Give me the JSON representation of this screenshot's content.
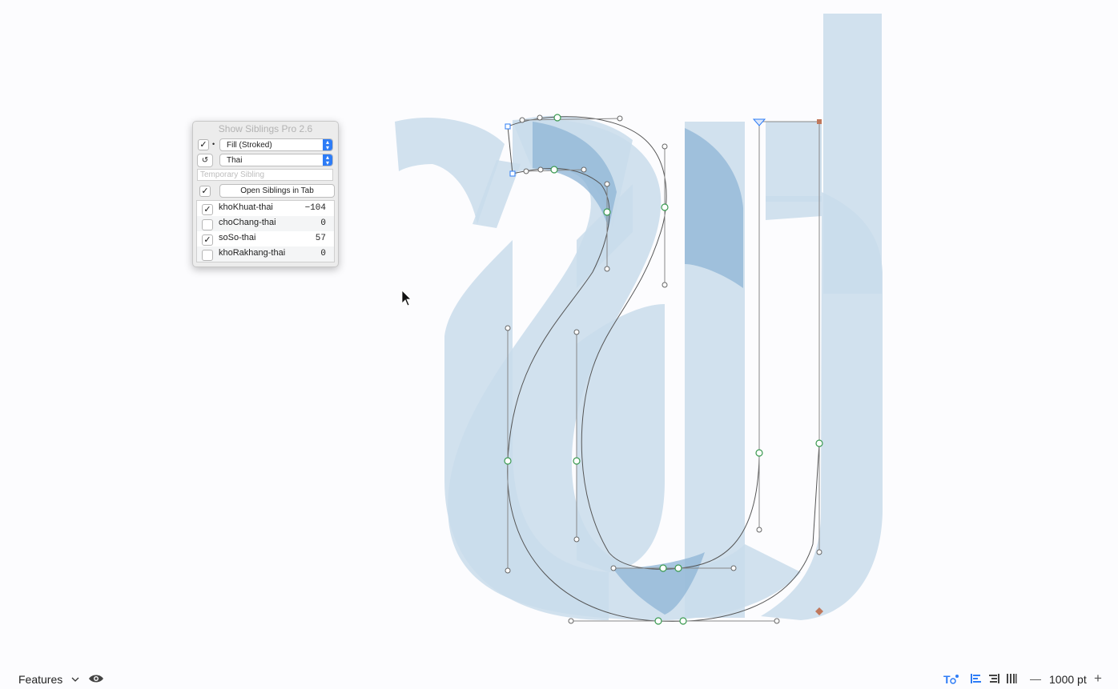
{
  "palette": {
    "title": "Show Siblings Pro 2.6",
    "fill_mode": "Fill (Stroked)",
    "script": "Thai",
    "temp_sibling_placeholder": "Temporary Sibling",
    "open_siblings_label": "Open Siblings in Tab",
    "refresh_icon": "↺",
    "siblings": [
      {
        "name": "khoKhuat-thai",
        "value": "−104",
        "checked": true
      },
      {
        "name": "choChang-thai",
        "value": "0",
        "checked": false
      },
      {
        "name": "soSo-thai",
        "value": "57",
        "checked": true
      },
      {
        "name": "khoRakhang-thai",
        "value": "0",
        "checked": false
      }
    ]
  },
  "bottombar": {
    "features_label": "Features",
    "zoom_value": "1000 pt",
    "minus": "—",
    "plus": "+"
  },
  "colors": {
    "sibling_fill": "#c9dceb",
    "overlap_fill": "#8db4d6",
    "accent": "#2d7cf6",
    "node_green": "#3a9a50",
    "anchor_brown": "#c0785c"
  }
}
